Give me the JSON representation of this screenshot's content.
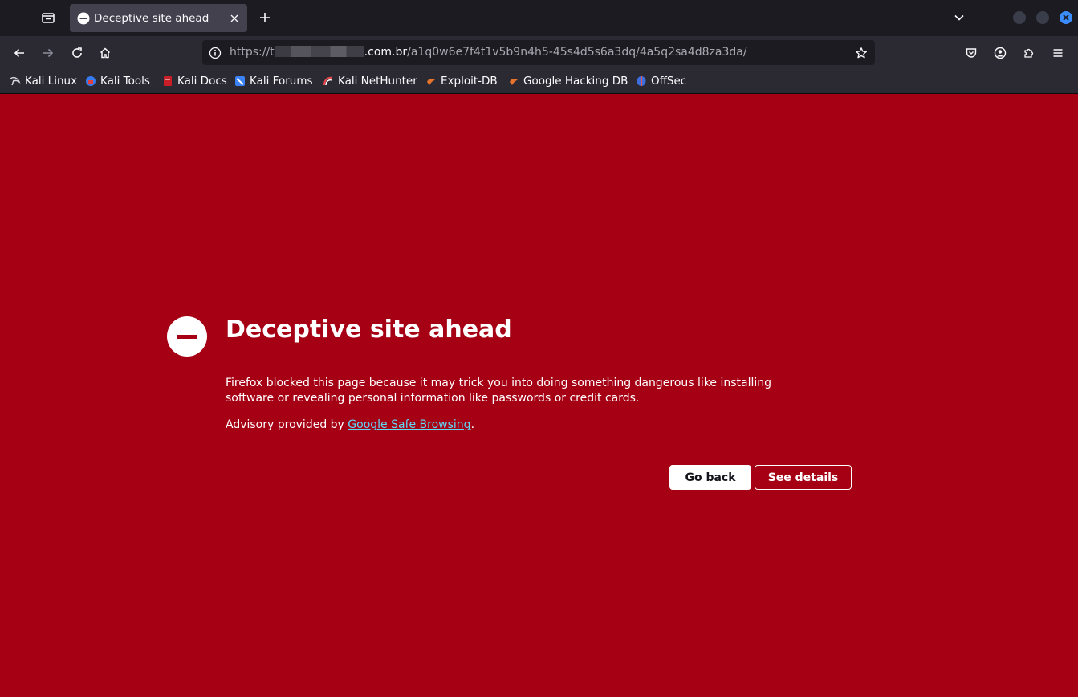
{
  "tabstrip": {
    "tab_list_icon": "tab-list-icon",
    "tab": {
      "title": "Deceptive site ahead",
      "favicon": "blocked-icon",
      "close_icon": "close-icon"
    },
    "new_tab_icon": "plus-icon",
    "overflow_icon": "chevron-down-icon",
    "window_controls": {
      "close_color": "#3a8cff"
    }
  },
  "navbar": {
    "back_icon": "back-arrow-icon",
    "forward_icon": "forward-arrow-icon",
    "reload_icon": "reload-icon",
    "home_icon": "home-icon",
    "url": {
      "scheme": "https://t",
      "domain_suffix": ".com.br",
      "path": "/a1q0w6e7f4t1v5b9n4h5-45s4d5s6a3dq/4a5q2sa4d8za3da/"
    },
    "tools": [
      "pocket-icon",
      "account-icon",
      "extensions-icon",
      "menu-icon"
    ]
  },
  "bookmarks": [
    {
      "label": "Kali Linux",
      "icon": "kali-dragon-icon"
    },
    {
      "label": "Kali Tools",
      "icon": "kali-tools-icon"
    },
    {
      "label": "Kali Docs",
      "icon": "kali-docs-icon"
    },
    {
      "label": "Kali Forums",
      "icon": "kali-forums-icon"
    },
    {
      "label": "Kali NetHunter",
      "icon": "nethunter-icon"
    },
    {
      "label": "Exploit-DB",
      "icon": "exploit-db-icon"
    },
    {
      "label": "Google Hacking DB",
      "icon": "ghdb-icon"
    },
    {
      "label": "OffSec",
      "icon": "offsec-icon"
    }
  ],
  "error_page": {
    "background_color": "#a50014",
    "title": "Deceptive site ahead",
    "description": "Firefox blocked this page because it may trick you into doing something dangerous like installing software or revealing personal information like passwords or credit cards.",
    "advisory_prefix": "Advisory provided by ",
    "advisory_link": "Google Safe Browsing",
    "advisory_suffix": ".",
    "go_back_label": "Go back",
    "see_details_label": "See details"
  }
}
